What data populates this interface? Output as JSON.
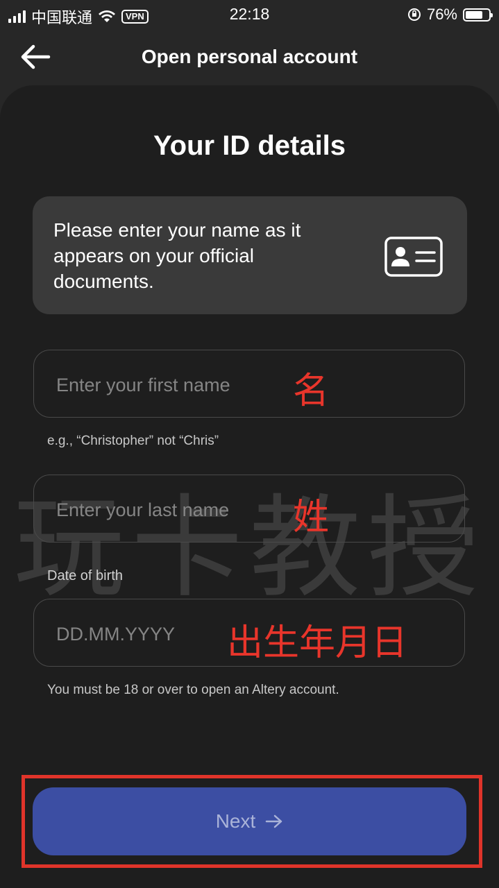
{
  "status_bar": {
    "carrier": "中国联通",
    "vpn": "VPN",
    "time": "22:18",
    "battery": "76%",
    "battery_level": 0.76
  },
  "header": {
    "title": "Open personal account"
  },
  "main": {
    "title": "Your ID details",
    "info_text": "Please enter your name as it appears on your official documents.",
    "first_name": {
      "placeholder": "Enter your first name",
      "annotation": "名",
      "hint": "e.g., “Christopher” not “Chris”"
    },
    "last_name": {
      "placeholder": "Enter your last name",
      "annotation": "姓"
    },
    "dob": {
      "label": "Date of birth",
      "placeholder": "DD.MM.YYYY",
      "annotation": "出生年月日",
      "hint": "You must be 18 or over to open an Altery account."
    },
    "next_label": "Next"
  },
  "watermark": "玩卡教授",
  "colors": {
    "accent_button": "#3c4ea3",
    "annotation_red": "#e8352b",
    "background": "#272727",
    "card": "#1e1e1e"
  }
}
